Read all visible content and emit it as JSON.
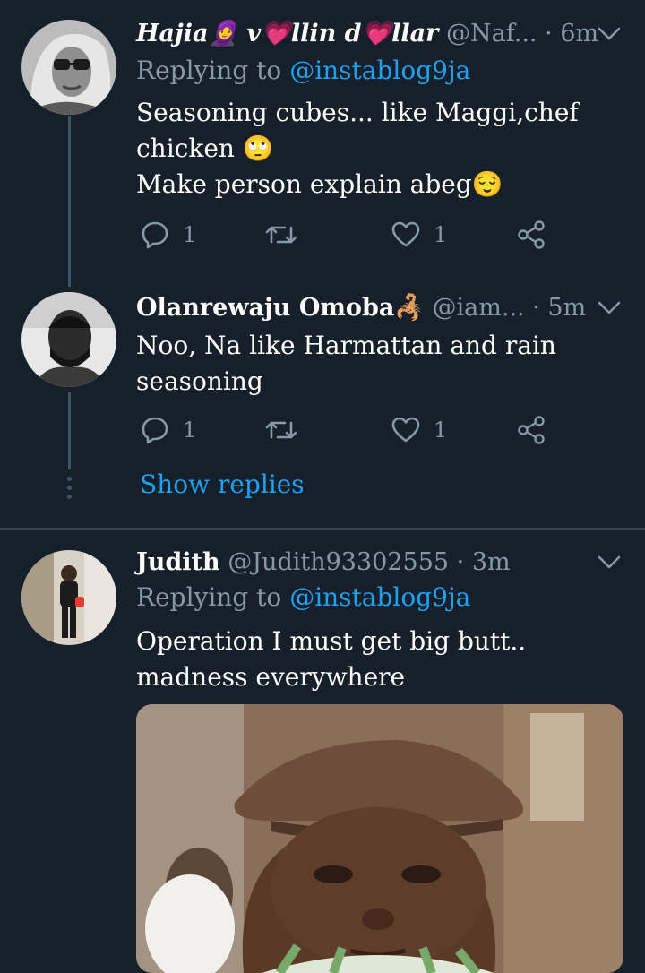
{
  "tweets": [
    {
      "display_name": "Hajia🧕 v💗llin d💗llar",
      "handle": "@Naf...",
      "separator": "·",
      "time": "6m",
      "replying_prefix": "Replying to",
      "replying_handle": "@instablog9ja",
      "text_lines": [
        "Seasoning cubes... like Maggi,chef",
        "chicken 🙄",
        "Make person explain abeg😌"
      ],
      "reply_count": "1",
      "retweet_count": "",
      "like_count": "1"
    },
    {
      "display_name": "Olanrewaju Omoba🦂",
      "handle": "@iam...",
      "separator": "·",
      "time": "5m",
      "text_lines": [
        "Noo, Na like Harmattan and rain",
        "seasoning"
      ],
      "reply_count": "1",
      "retweet_count": "",
      "like_count": "1"
    },
    {
      "display_name": "Judith",
      "handle": "@Judith93302555",
      "separator": "·",
      "time": "3m",
      "replying_prefix": "Replying to",
      "replying_handle": "@instablog9ja",
      "text_lines": [
        "Operation I must get big butt..",
        "madness everywhere"
      ]
    }
  ],
  "show_replies_label": "Show replies",
  "colors": {
    "background": "#15202b",
    "primary_text": "#ffffff",
    "secondary_text": "#8899a6",
    "accent": "#1da1f2",
    "thread_line": "#3d5466",
    "divider": "#38444d"
  },
  "icons": {
    "reply": "reply-icon",
    "retweet": "retweet-icon",
    "like": "heart-icon",
    "share": "share-icon",
    "caret": "chevron-down-icon"
  }
}
